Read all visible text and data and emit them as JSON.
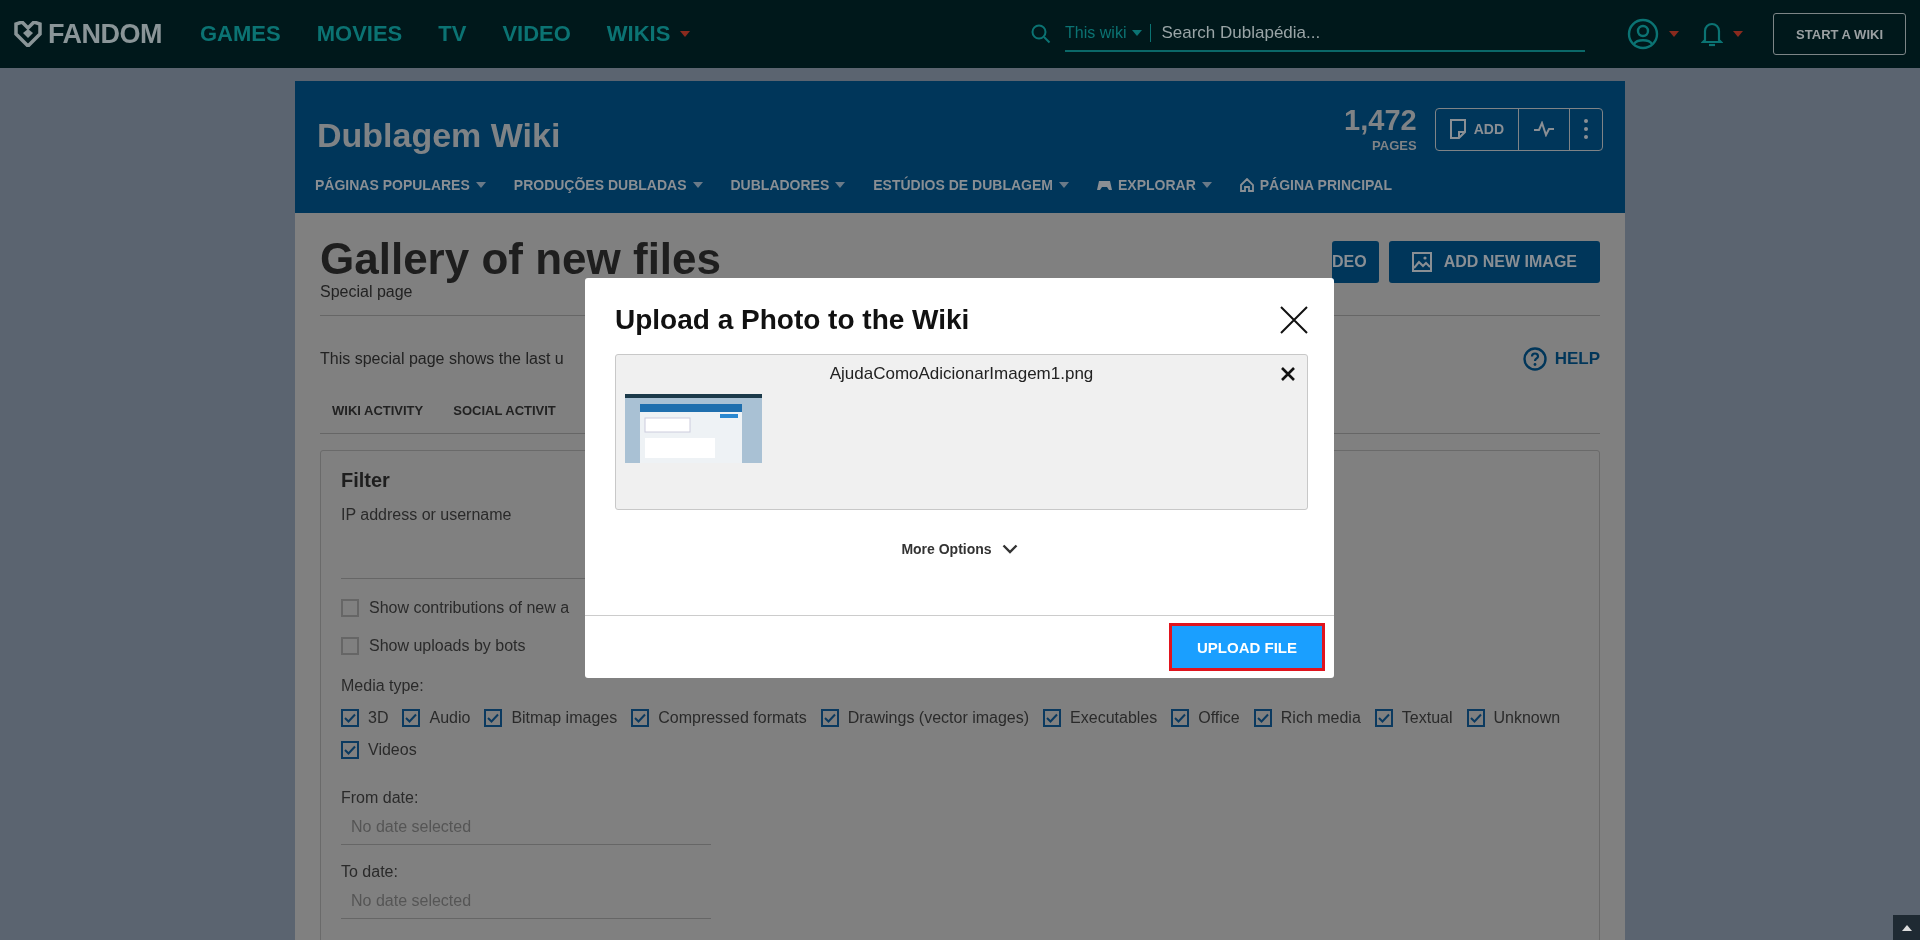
{
  "top_nav": {
    "logo": "FANDOM",
    "items": [
      {
        "label": "GAMES",
        "dropdown": false
      },
      {
        "label": "MOVIES",
        "dropdown": false
      },
      {
        "label": "TV",
        "dropdown": false
      },
      {
        "label": "VIDEO",
        "dropdown": false
      },
      {
        "label": "WIKIS",
        "dropdown": true
      }
    ],
    "search": {
      "scope": "This wiki",
      "placeholder": "Search Dublapédia..."
    },
    "start_button": "START A WIKI"
  },
  "wiki_header": {
    "title": "Dublagem Wiki",
    "page_count": "1,472",
    "page_count_label": "PAGES",
    "add_button": "ADD",
    "nav": [
      {
        "label": "PÁGINAS POPULARES",
        "kind": "dropdown"
      },
      {
        "label": "PRODUÇÕES DUBLADAS",
        "kind": "dropdown"
      },
      {
        "label": "DUBLADORES",
        "kind": "dropdown"
      },
      {
        "label": "ESTÚDIOS DE DUBLAGEM",
        "kind": "dropdown"
      },
      {
        "label": "EXPLORAR",
        "kind": "explore"
      },
      {
        "label": "PÁGINA PRINCIPAL",
        "kind": "home"
      }
    ]
  },
  "page": {
    "title": "Gallery of new files",
    "subtitle": "Special page",
    "buttons": [
      {
        "label": "DEO",
        "kind": "video"
      },
      {
        "label": "ADD NEW IMAGE",
        "kind": "image"
      }
    ],
    "intro": "This special page shows the last u",
    "help": "HELP",
    "tabs": [
      {
        "label": "WIKI ACTIVITY",
        "selected": false
      },
      {
        "label": "SOCIAL ACTIVIT",
        "selected": false
      }
    ]
  },
  "filter": {
    "title": "Filter",
    "user_label": "IP address or username",
    "options": [
      {
        "label": "Show contributions of new a",
        "checked": false
      },
      {
        "label": "Show uploads by bots",
        "checked": false
      }
    ],
    "media_type_label": "Media type:",
    "media_types": [
      {
        "label": "3D",
        "checked": true
      },
      {
        "label": "Audio",
        "checked": true
      },
      {
        "label": "Bitmap images",
        "checked": true
      },
      {
        "label": "Compressed formats",
        "checked": true
      },
      {
        "label": "Drawings (vector images)",
        "checked": true
      },
      {
        "label": "Executables",
        "checked": true
      },
      {
        "label": "Office",
        "checked": true
      },
      {
        "label": "Rich media",
        "checked": true
      },
      {
        "label": "Textual",
        "checked": true
      },
      {
        "label": "Unknown",
        "checked": true
      },
      {
        "label": "Videos",
        "checked": true
      }
    ],
    "from_label": "From date:",
    "from_placeholder": "No date selected",
    "to_label": "To date:",
    "to_placeholder": "No date selected"
  },
  "modal": {
    "title": "Upload a Photo to the Wiki",
    "file_name": "AjudaComoAdicionarImagem1.png",
    "more_options": "More Options",
    "upload_button": "UPLOAD FILE"
  }
}
